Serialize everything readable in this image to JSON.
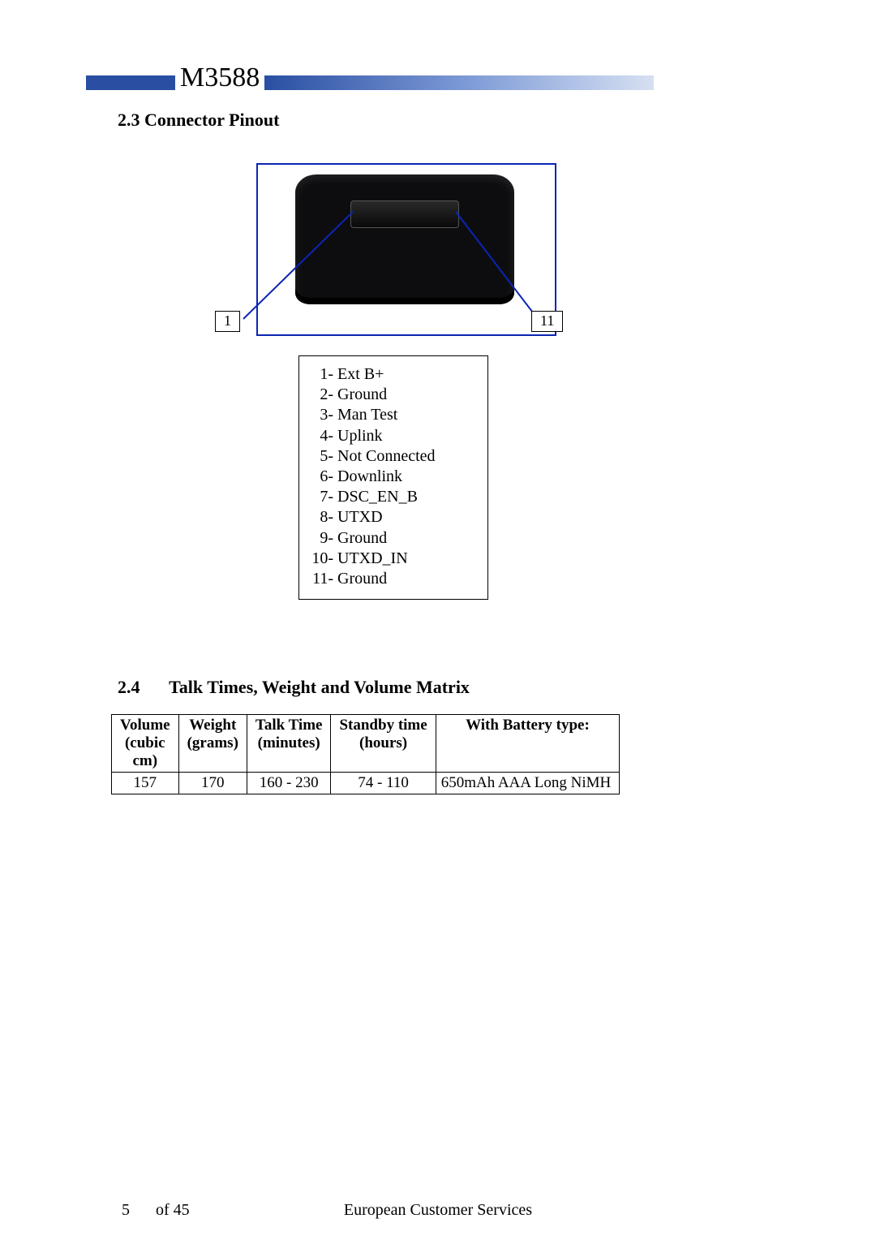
{
  "header": {
    "model": "M3588"
  },
  "sections": {
    "s23": {
      "number": "2.3",
      "title": "Connector Pinout"
    },
    "s24": {
      "number": "2.4",
      "title": "Talk Times, Weight and Volume Matrix"
    }
  },
  "connector": {
    "left_label": "1",
    "right_label": "11",
    "pins": [
      {
        "n": "1",
        "name": "Ext B+"
      },
      {
        "n": "2",
        "name": "Ground"
      },
      {
        "n": "3",
        "name": "Man Test"
      },
      {
        "n": "4",
        "name": "Uplink"
      },
      {
        "n": "5",
        "name": "Not Connected"
      },
      {
        "n": "6",
        "name": "Downlink"
      },
      {
        "n": "7",
        "name": "DSC_EN_B"
      },
      {
        "n": "8",
        "name": "UTXD"
      },
      {
        "n": "9",
        "name": "Ground"
      },
      {
        "n": "10",
        "name": "UTXD_IN"
      },
      {
        "n": "11",
        "name": "Ground"
      }
    ]
  },
  "matrix": {
    "headers": {
      "volume": "Volume (cubic cm)",
      "weight": "Weight (grams)",
      "talk": "Talk Time (minutes)",
      "standby": "Standby time (hours)",
      "battery": "With Battery type:"
    },
    "rows": [
      {
        "volume": "157",
        "weight": "170",
        "talk": "160 - 230",
        "standby": "74 - 110",
        "battery": "650mAh AAA Long NiMH"
      }
    ]
  },
  "chart_data": {
    "type": "table",
    "title": "Talk Times, Weight and Volume Matrix",
    "columns": [
      "Volume (cubic cm)",
      "Weight (grams)",
      "Talk Time (minutes)",
      "Standby time (hours)",
      "With Battery type:"
    ],
    "rows": [
      [
        "157",
        "170",
        "160 - 230",
        "74 - 110",
        "650mAh AAA Long NiMH"
      ]
    ]
  },
  "footer": {
    "page": "5",
    "of": "of 45",
    "center": "European Customer Services"
  }
}
